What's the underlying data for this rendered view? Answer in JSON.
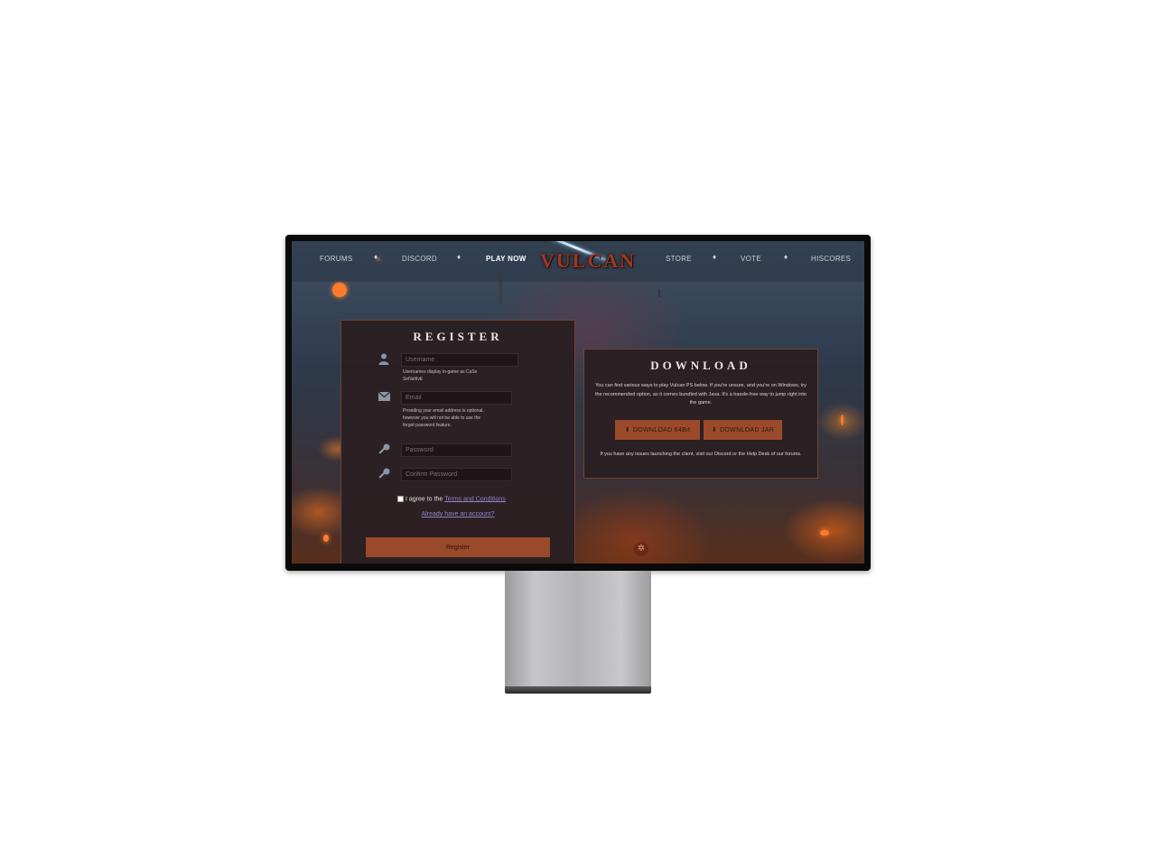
{
  "nav": {
    "left": [
      "FORUMS",
      "DISCORD",
      "PLAY NOW"
    ],
    "right": [
      "STORE",
      "VOTE",
      "HISCORES"
    ],
    "logo": "VULCAN",
    "separator": "♦"
  },
  "register": {
    "title": "REGISTER",
    "username_placeholder": "Username",
    "username_hint": "Usernames display in-game as CaSe SeNsItIvE",
    "email_placeholder": "Email",
    "email_hint": "Providing your email address is optional, however you will not be able to use the forgot password feature.",
    "password_placeholder": "Password",
    "confirm_placeholder": "Confirm Password",
    "agree_text": "I agree to the",
    "terms_link": "Terms and Conditions",
    "already_link": "Already have an account?",
    "submit_label": "Register"
  },
  "download": {
    "title": "DOWNLOAD",
    "description": "You can find various ways to play Vulcan PS below. If you're unsure, and you're on Windows, try the recommended option, as it comes bundled with Java. It's a hassle-free way to jump right into the game.",
    "btn_64": "DOWNLOAD 64Bit",
    "btn_jar": "DOWNLOAD JAR",
    "footer": "If you have any issues launching the client, visit our Discord or the Help Desk of our forums."
  },
  "icons": {
    "user": "user-icon",
    "email": "envelope-icon",
    "password": "key-icon",
    "confirm": "key-icon",
    "download": "download-icon"
  },
  "colors": {
    "accent": "#9a4a2a",
    "panel": "#2b1f22",
    "link": "#8f83c8"
  }
}
